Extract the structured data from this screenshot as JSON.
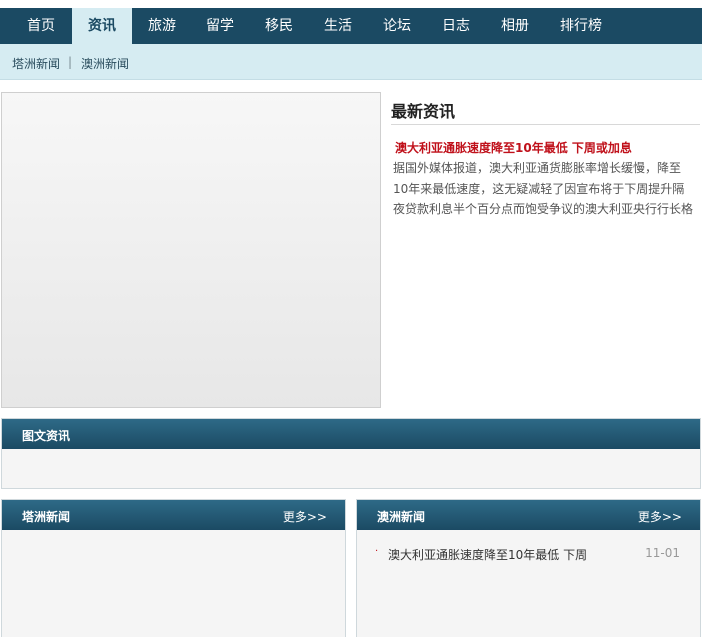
{
  "nav": {
    "items": [
      "首页",
      "资讯",
      "旅游",
      "留学",
      "移民",
      "生活",
      "论坛",
      "日志",
      "相册",
      "排行榜"
    ],
    "active": "资讯"
  },
  "subnav": {
    "links": [
      "塔洲新闻",
      "澳洲新闻"
    ],
    "separator": "|"
  },
  "latest": {
    "title": "最新资讯",
    "headline": "澳大利亚通胀速度降至10年最低  下周或加息",
    "summary": "据国外媒体报道，澳大利亚通货膨胀率增长缓慢，降至10年来最低速度，这无疑减轻了因宣布将于下周提升隔夜贷款利息半个百分点而饱受争议的澳大利亚央行行长格"
  },
  "sections": {
    "photo_news": {
      "title": "图文资讯"
    },
    "taz_news": {
      "title": "塔洲新闻",
      "more": "更多>>"
    },
    "aus_news": {
      "title": "澳洲新闻",
      "more": "更多>>",
      "items": [
        {
          "bullet": "·",
          "title": "澳大利亚通胀速度降至10年最低  下周",
          "date": "11-01"
        }
      ]
    }
  },
  "colors": {
    "nav_bg": "#1b4a63",
    "subnav_bg": "#d6ecf2",
    "headline": "#c0111b"
  }
}
